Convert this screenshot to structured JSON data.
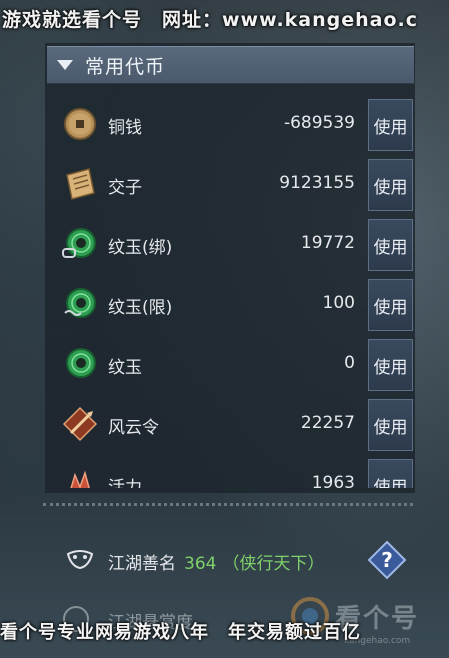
{
  "top_banner": "游戏就选看个号　网址：www.kangehao.c",
  "section": {
    "title": "常用代币"
  },
  "currencies": [
    {
      "name": "铜钱",
      "amount": "-689539",
      "icon": "copper-coin-icon",
      "button": "使用"
    },
    {
      "name": "交子",
      "amount": "9123155",
      "icon": "paper-note-icon",
      "button": "使用"
    },
    {
      "name": "纹玉(绑)",
      "amount": "19772",
      "icon": "jade-bound-icon",
      "button": "使用"
    },
    {
      "name": "纹玉(限)",
      "amount": "100",
      "icon": "jade-limited-icon",
      "button": "使用"
    },
    {
      "name": "纹玉",
      "amount": "0",
      "icon": "jade-icon",
      "button": "使用"
    },
    {
      "name": "风云令",
      "amount": "22257",
      "icon": "wind-cloud-token-icon",
      "button": "使用"
    },
    {
      "name": "活力",
      "amount": "1963",
      "icon": "vitality-icon",
      "button": "使用"
    }
  ],
  "fame": {
    "label": "江湖善名",
    "value": "364",
    "title": "（侠行天下）"
  },
  "next_item": {
    "label": "江湖悬赏度"
  },
  "bottom_banner": "看个号专业网易游戏八年　年交易额过百亿",
  "watermark": {
    "text": "看个号",
    "url": "kangehao.com"
  },
  "colors": {
    "fame_green": "#7fd16a",
    "header_bg": "#55657a",
    "button_bg": "#34445a"
  }
}
